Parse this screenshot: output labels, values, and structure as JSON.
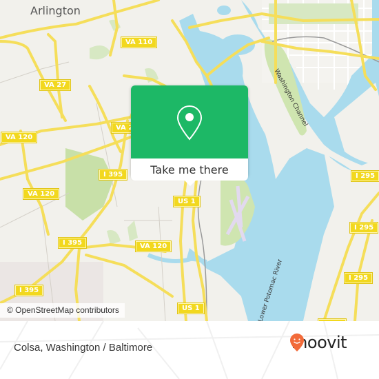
{
  "map": {
    "place_labels": [
      {
        "name": "arlington",
        "text": "Arlington"
      }
    ],
    "road_shields": [
      {
        "id": "va110",
        "text": "VA 110"
      },
      {
        "id": "va27",
        "text": "VA 27"
      },
      {
        "id": "va2",
        "text": "VA 2"
      },
      {
        "id": "va120-a",
        "text": "VA 120"
      },
      {
        "id": "va120-b",
        "text": "VA 120"
      },
      {
        "id": "va120-c",
        "text": "VA 120"
      },
      {
        "id": "i395-a",
        "text": "I 395"
      },
      {
        "id": "i395-b",
        "text": "I 395"
      },
      {
        "id": "i395-c",
        "text": "I 395"
      },
      {
        "id": "us1-a",
        "text": "US 1"
      },
      {
        "id": "us1-b",
        "text": "US 1"
      },
      {
        "id": "i295-a",
        "text": "I 295"
      },
      {
        "id": "i295-b",
        "text": "I 295"
      },
      {
        "id": "i295-c",
        "text": "I 295"
      }
    ],
    "water_labels": [
      {
        "id": "washington-channel",
        "text": "Washington Channel"
      },
      {
        "id": "potomac",
        "text": "Lower Potomac River"
      }
    ],
    "attribution": "© OpenStreetMap contributors",
    "colors": {
      "land": "#f2f1ec",
      "water": "#a9dbed",
      "park": "#cfe5b0",
      "road": "#f5de5a",
      "airport": "#e2d9ef"
    }
  },
  "popup": {
    "icon": "location-pin-icon",
    "button_label": "Take me there",
    "color": "#1db866"
  },
  "footer": {
    "title": "Colsa, Washington / Baltimore",
    "logo_text": "moovit",
    "logo_color": "#f26b3a"
  }
}
